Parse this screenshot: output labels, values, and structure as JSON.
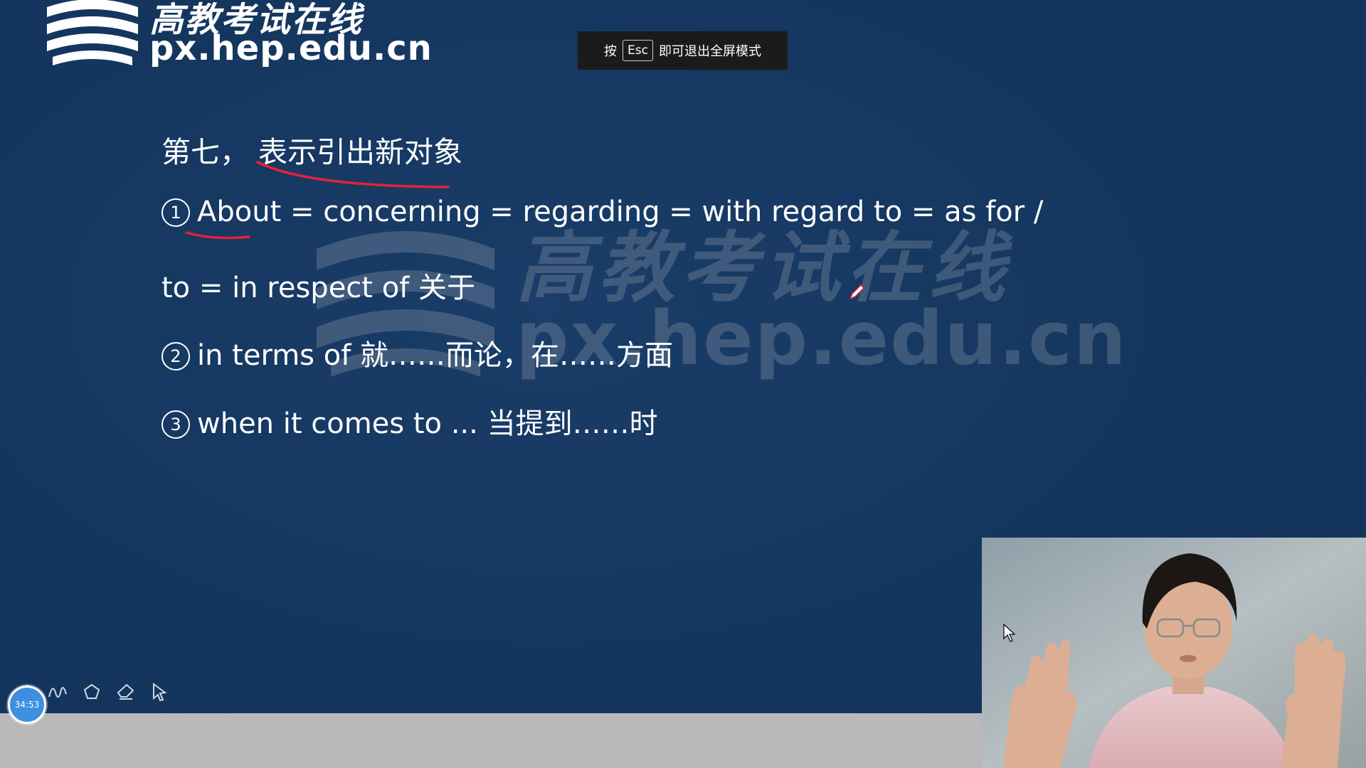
{
  "logo": {
    "chinese_name": "高教考试在线",
    "url_text": "px.hep.edu.cn"
  },
  "watermark": {
    "chinese_name": "高教考试在线",
    "url_text": "px.hep.edu.cn"
  },
  "fullscreen_notice": {
    "prefix": "按",
    "key": "Esc",
    "suffix": "即可退出全屏模式"
  },
  "slide": {
    "heading_prefix": "第七，",
    "heading_topic": "表示引出新对象",
    "items": [
      {
        "marker": "1",
        "text_main": "About",
        "text_rest": " = concerning = regarding = with regard to = as for /"
      },
      {
        "marker": "",
        "text_main": "",
        "text_rest": "to = in respect of 关于"
      },
      {
        "marker": "2",
        "text_main": "",
        "text_rest": "in terms of 就……而论，在……方面"
      },
      {
        "marker": "3",
        "text_main": "",
        "text_rest": "when it comes to ... 当提到……时"
      }
    ]
  },
  "toolbar": {
    "tools": [
      "pen-tool-icon",
      "curve-tool-icon",
      "shape-tool-icon",
      "eraser-tool-icon",
      "pointer-tool-icon"
    ]
  },
  "timer": {
    "elapsed": "34:53"
  },
  "colors": {
    "slide_background": "#14365e",
    "annotation_red": "#e8203a",
    "bottom_bar": "#b9b9b9",
    "timer_blue": "#3d8fe0"
  }
}
